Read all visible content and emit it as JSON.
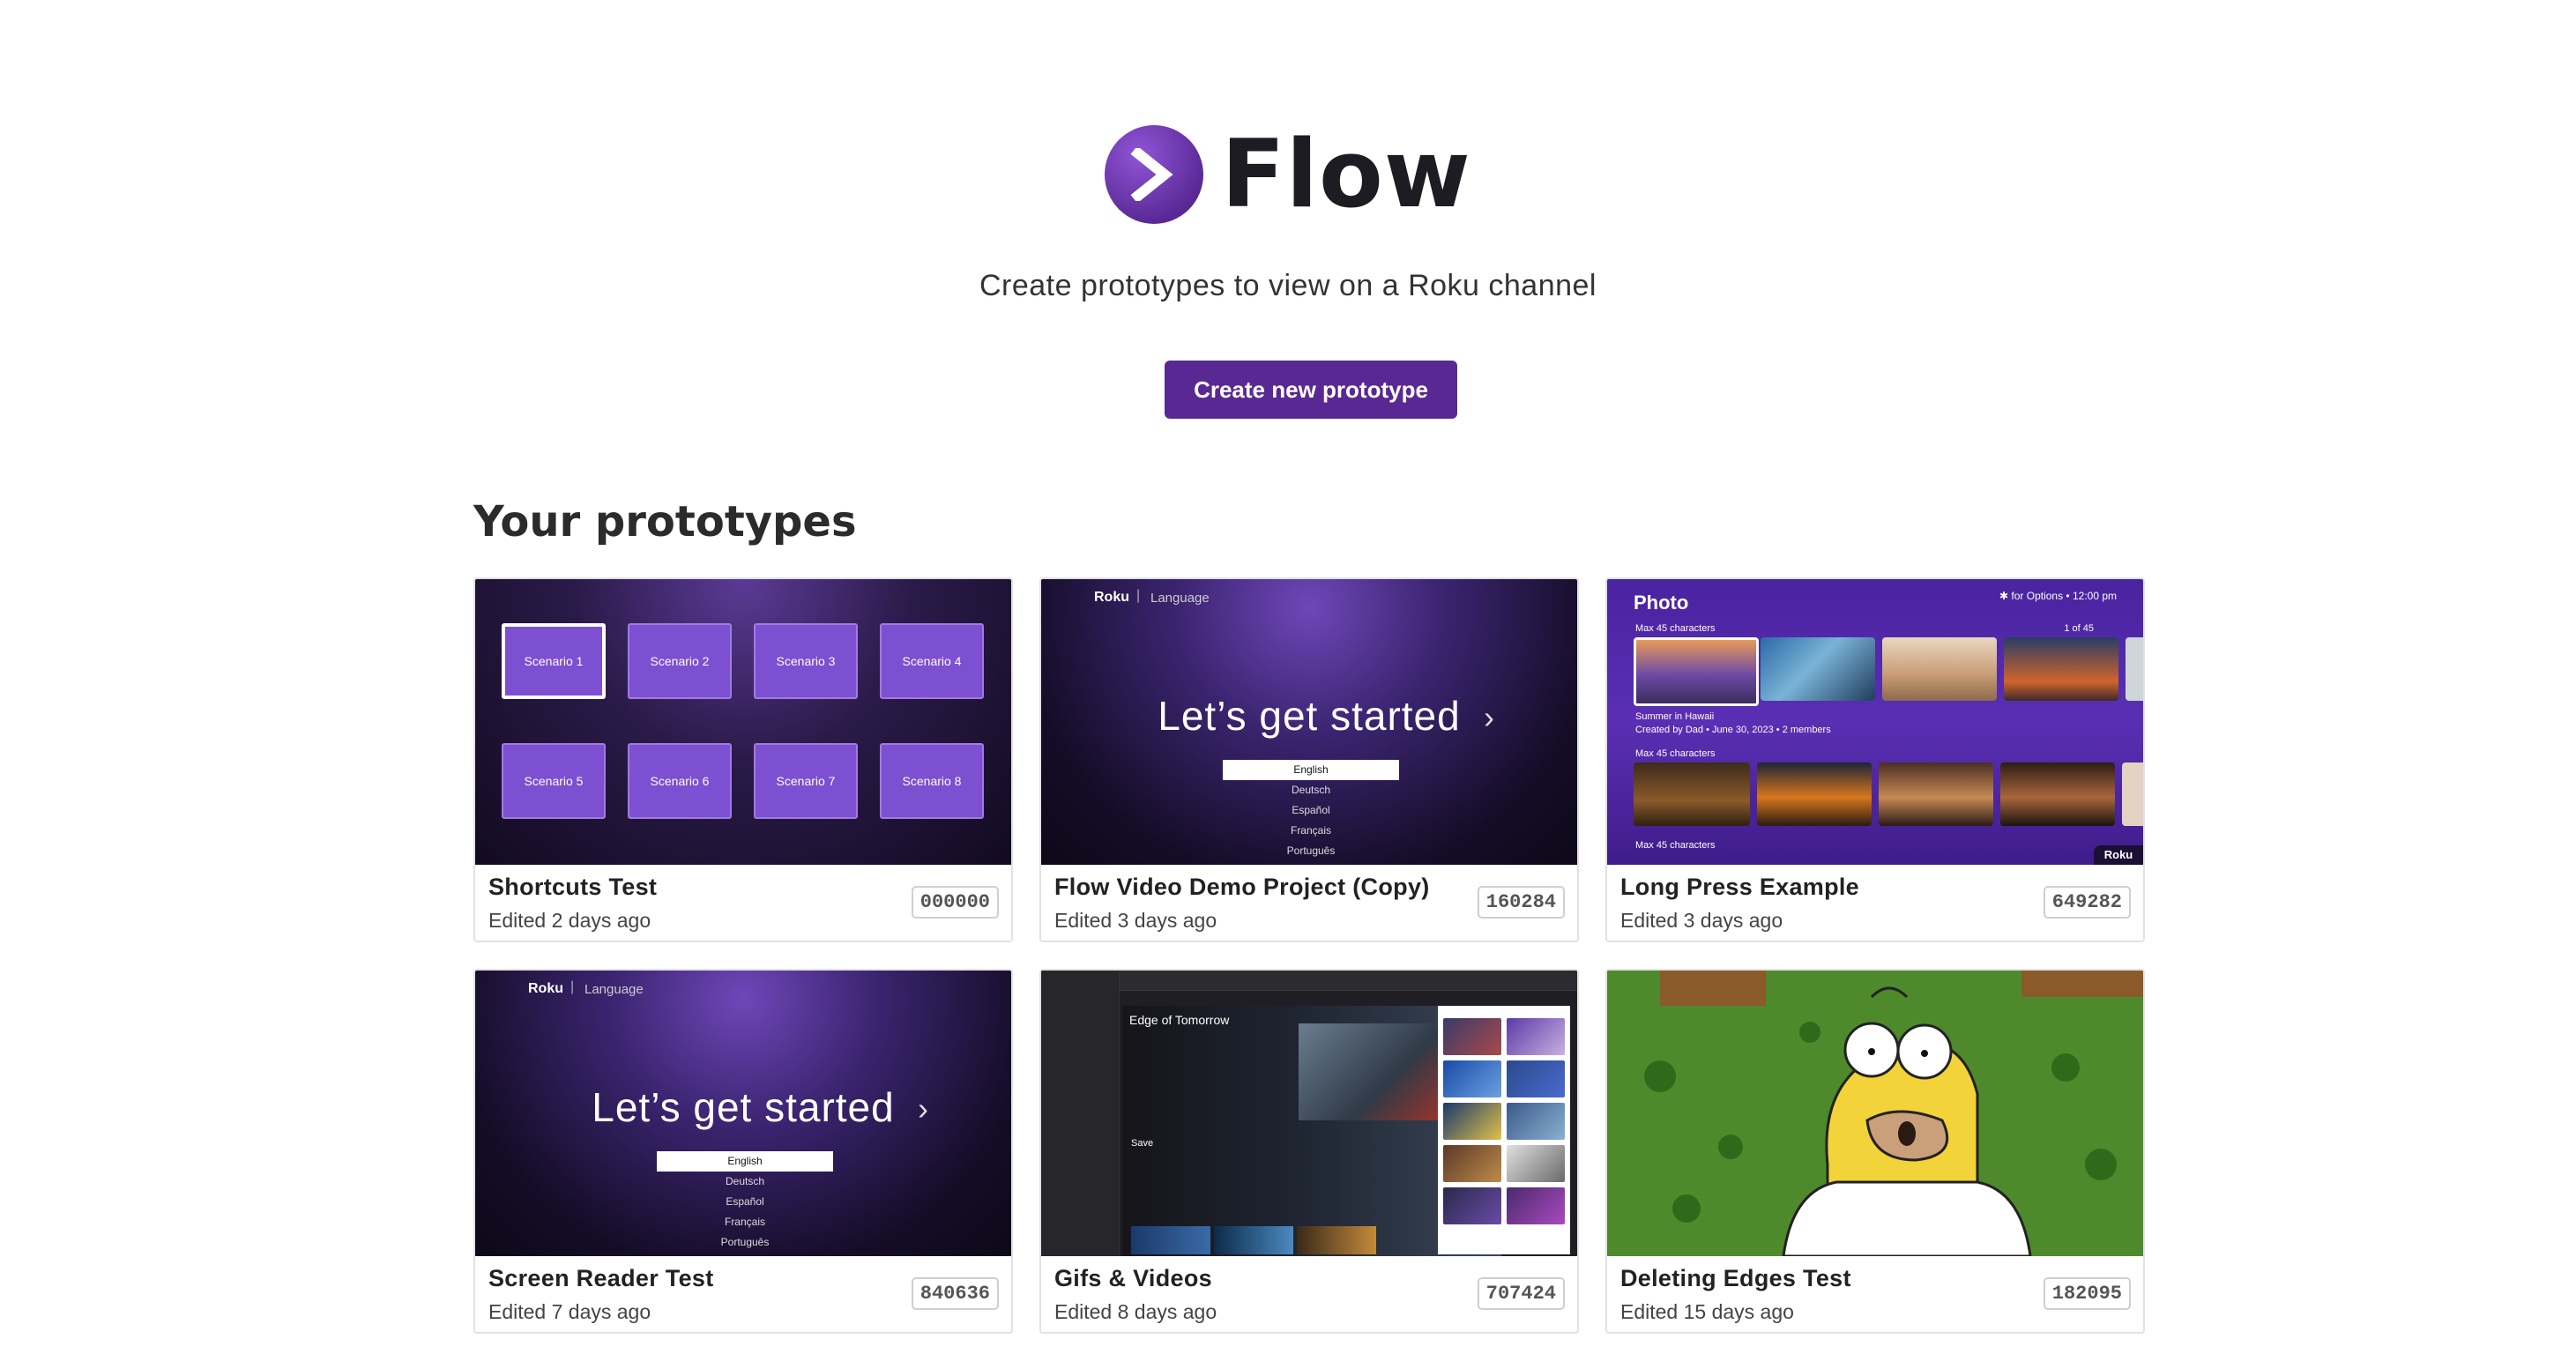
{
  "header": {
    "logo_text": "Flow",
    "subtitle": "Create prototypes to view on a Roku channel",
    "create_button": "Create new prototype"
  },
  "section_title": "Your prototypes",
  "prototypes": [
    {
      "name": "Shortcuts Test",
      "edited": "Edited 2 days ago",
      "code": "000000"
    },
    {
      "name": "Flow Video Demo Project (Copy)",
      "edited": "Edited 3 days ago",
      "code": "160284"
    },
    {
      "name": "Long Press Example",
      "edited": "Edited 3 days ago",
      "code": "649282"
    },
    {
      "name": "Screen Reader Test",
      "edited": "Edited 7 days ago",
      "code": "840636"
    },
    {
      "name": "Gifs & Videos",
      "edited": "Edited 8 days ago",
      "code": "707424"
    },
    {
      "name": "Deleting Edges Test",
      "edited": "Edited 15 days ago",
      "code": "182095"
    }
  ],
  "thumbs": {
    "shortcuts": {
      "scenarios": [
        "Scenario 1",
        "Scenario 2",
        "Scenario 3",
        "Scenario 4",
        "Scenario 5",
        "Scenario 6",
        "Scenario 7",
        "Scenario 8"
      ]
    },
    "language": {
      "brand": "Roku",
      "heading": "Language",
      "title": "Let’s get started",
      "options": [
        "English",
        "Deutsch",
        "Español",
        "Français",
        "Português"
      ]
    },
    "photo": {
      "brand": "Photo",
      "meta": "✱ for Options  •  12:00 pm",
      "row1_label": "Max 45 characters",
      "row1_count": "1 of 45",
      "caption_title": "Summer in Hawaii",
      "caption_sub": "Created by Dad • June 30, 2023 • 2 members",
      "row2_label": "Max 45 characters",
      "row3_label": "Max 45 characters",
      "corner_brand": "Roku"
    },
    "gifs": {
      "movie_title": "Edge of Tomorrow",
      "save_label": "Save"
    }
  },
  "colors": {
    "brand_purple": "#5a2893",
    "card_border": "#e2e2e2"
  }
}
